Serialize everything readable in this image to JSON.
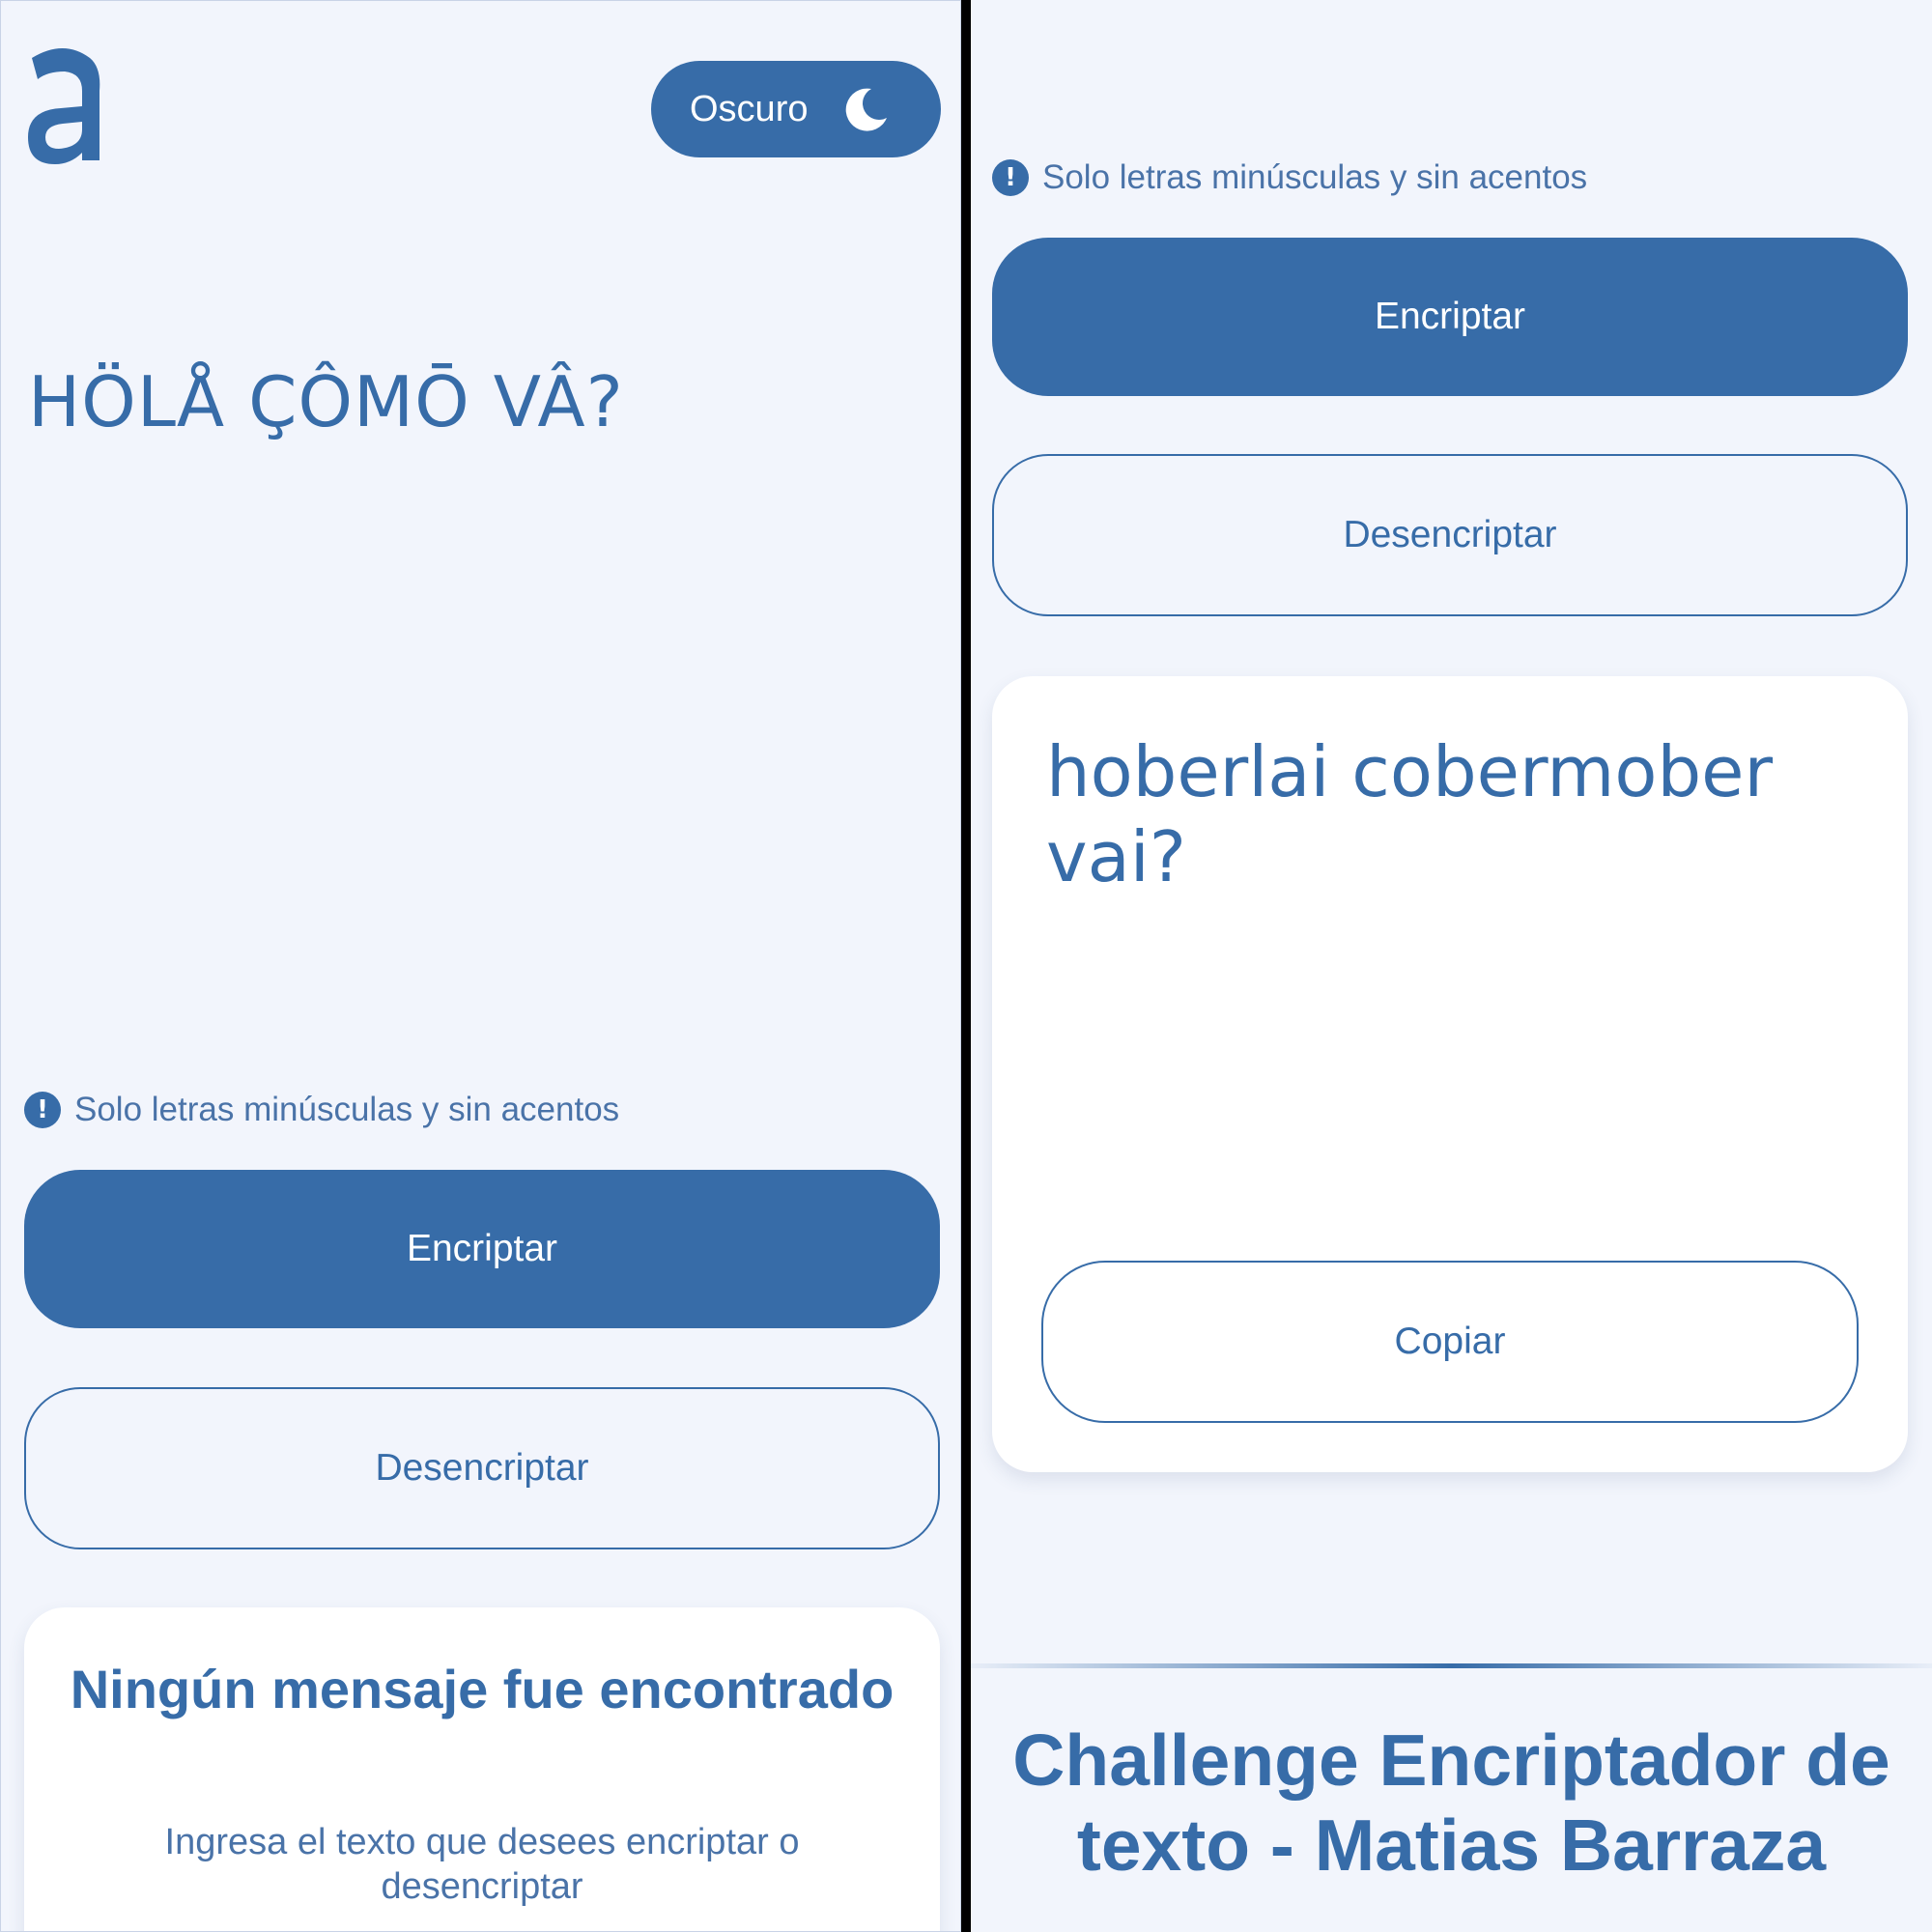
{
  "header": {
    "logo_letter": "a",
    "theme_toggle_label": "Oscuro",
    "theme_icon": "moon-icon"
  },
  "input": {
    "value": "HÖLÅ ÇÔMŌ VÂ?"
  },
  "hint": {
    "icon": "info-icon",
    "icon_glyph": "!",
    "text": "Solo letras minúsculas y sin acentos"
  },
  "buttons": {
    "encrypt_label": "Encriptar",
    "decrypt_label": "Desencriptar",
    "copy_label": "Copiar"
  },
  "empty_state": {
    "title": "Ningún mensaje fue encontrado",
    "description": "Ingresa el texto que desees encriptar o desencriptar"
  },
  "output": {
    "value": "hoberlai cobermober vai?"
  },
  "footer": {
    "text": "Challenge Encriptador de texto - Matias Barraza"
  },
  "colors": {
    "accent": "#376ca8",
    "background": "#f2f5fc",
    "card": "#ffffff"
  }
}
